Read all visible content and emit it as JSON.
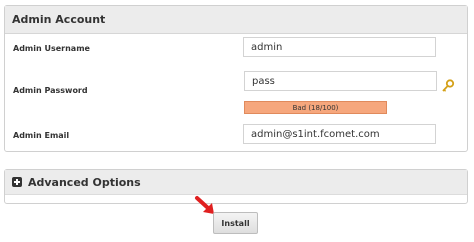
{
  "account": {
    "title": "Admin Account",
    "username": {
      "label": "Admin Username",
      "value": "admin"
    },
    "password": {
      "label": "Admin Password",
      "value": "pass",
      "strength": "Bad (18/100)"
    },
    "email": {
      "label": "Admin Email",
      "value": "admin@s1int.fcomet.com"
    }
  },
  "advanced": {
    "title": "Advanced Options"
  },
  "actions": {
    "install_label": "Install"
  },
  "colors": {
    "strength_bad": "#f6a77d",
    "arrow": "#e02020"
  }
}
